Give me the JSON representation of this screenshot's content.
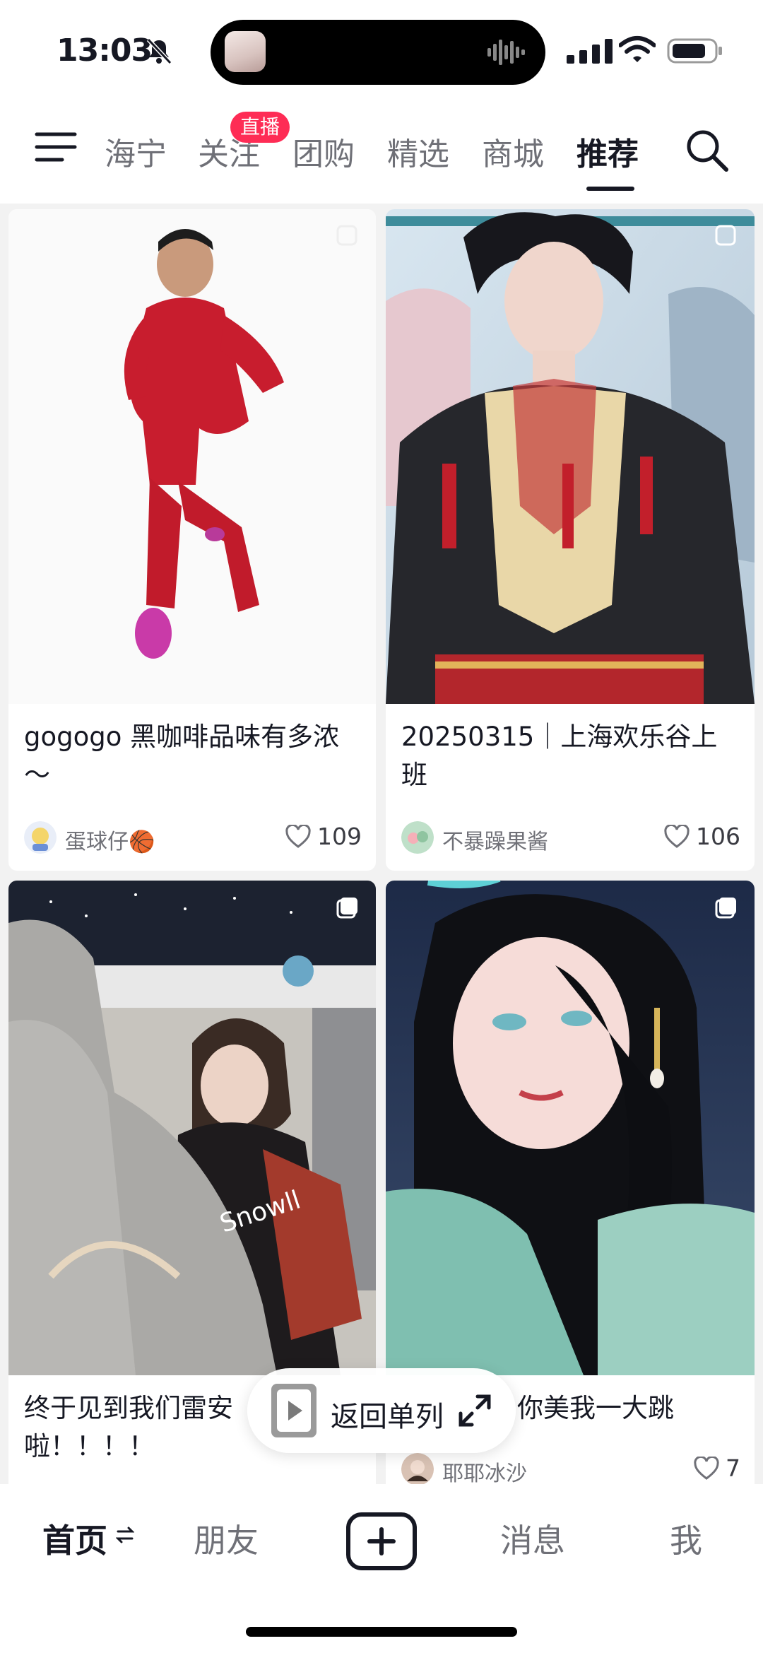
{
  "status_bar": {
    "time": "13:03"
  },
  "top_tabs": {
    "items": [
      {
        "label": "海宁"
      },
      {
        "label": "关注"
      },
      {
        "label": "团购"
      },
      {
        "label": "精选"
      },
      {
        "label": "商城"
      },
      {
        "label": "推荐",
        "active": true
      }
    ],
    "live_badge": "直播"
  },
  "feed": {
    "cards": [
      {
        "title": "gogogo 黑咖啡品味有多浓～",
        "author": "蛋球仔🏀",
        "likes": "109"
      },
      {
        "title": "20250315｜上海欢乐谷上班",
        "author": "不暴躁果酱",
        "likes": "106"
      },
      {
        "title": "终于见到我们雷安啦！！！！",
        "author": "",
        "likes": ""
      },
      {
        "title": "你美我一大跳",
        "author": "耶耶冰沙",
        "likes": "7"
      }
    ]
  },
  "floating_pill": {
    "label": "返回单列"
  },
  "bottom_nav": {
    "items": [
      {
        "label": "首页",
        "active": true
      },
      {
        "label": "朋友"
      },
      {
        "label": "消息"
      },
      {
        "label": "我"
      }
    ]
  },
  "colors": {
    "accent": "#fe2c55",
    "text": "#161823",
    "muted": "#6f7077"
  },
  "icons": [
    "menu-icon",
    "search-icon",
    "heart-icon",
    "play-icon",
    "expand-icon",
    "plus-icon",
    "mute-icon",
    "wifi-icon",
    "battery-icon"
  ]
}
